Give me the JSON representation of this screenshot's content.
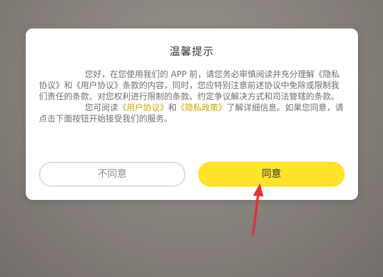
{
  "dialog": {
    "title": "温馨提示",
    "paragraph1": "您好，在您使用我们的 APP 前，请您务必审慎阅读并充分理解《隐私协议》和《用户协议》条款的内容，同时，您应特别注意前述协议中免除或限制我们责任的条款、对您权利进行限制的条款、约定争议解决方式和司法管辖的条款。",
    "paragraph2_prefix": "您可阅读",
    "link_user_agreement": "《用户协议》",
    "paragraph2_and": "和",
    "link_privacy_policy": "《隐私政策》",
    "paragraph2_suffix": "了解详细信息。如果您同意，请点击下面按钮开始接受我们的服务。",
    "disagree_label": "不同意",
    "agree_label": "同意"
  },
  "colors": {
    "accent": "#ffe22a",
    "link": "#d0a400",
    "annotation_arrow": "#e3342f"
  },
  "icons": {
    "annotation": "red-arrow-icon"
  }
}
